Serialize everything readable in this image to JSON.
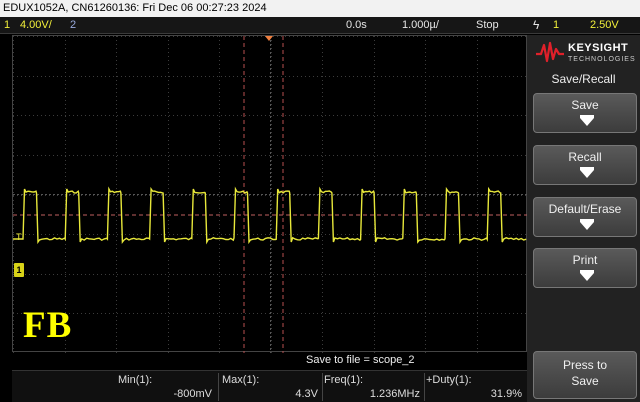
{
  "title_bar": {
    "text": "EDUX1052A, CN61260136: Fri Dec 06 00:27:23 2024"
  },
  "status_bar": {
    "ch1_num": "1",
    "ch1_scale": "4.00V/",
    "ch2_num": "2",
    "time_delay": "0.0s",
    "time_scale": "1.000µ/",
    "run_state": "Stop",
    "trigger_icon": "ϟ",
    "trig_source": "1",
    "trig_level": "2.50V"
  },
  "grid": {
    "colors": {
      "grid": "#3c3c3c",
      "trace": "#e8e83a",
      "trigger_line": "#c06060",
      "cursor": "#b85050"
    }
  },
  "scope": {
    "ch1_marker": "1",
    "trig_marker": "T",
    "overlay_label": "FB"
  },
  "measurements": {
    "save_message": "Save to file = scope_2",
    "items": [
      {
        "label": "Min(1):",
        "value": "-800mV"
      },
      {
        "label": "Max(1):",
        "value": "4.3V"
      },
      {
        "label": "Freq(1):",
        "value": "1.236MHz"
      },
      {
        "label": "+Duty(1):",
        "value": "31.9%"
      }
    ]
  },
  "softkeys": {
    "brand_name": "KEYSIGHT",
    "brand_sub": "TECHNOLOGIES",
    "menu_title": "Save/Recall",
    "keys": [
      {
        "label": "Save"
      },
      {
        "label": "Recall"
      },
      {
        "label": "Default/Erase"
      },
      {
        "label": "Print"
      }
    ],
    "press_label_line1": "Press to",
    "press_label_line2": "Save"
  }
}
